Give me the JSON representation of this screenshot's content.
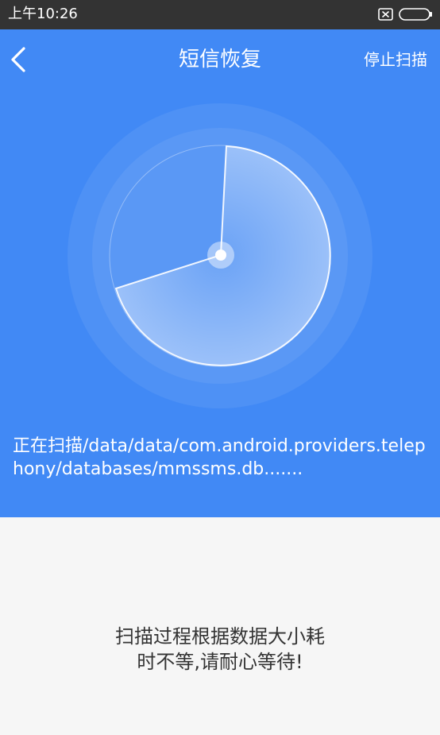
{
  "status_bar": {
    "time": "上午10:26"
  },
  "header": {
    "title": "短信恢复",
    "stop_label": "停止扫描"
  },
  "scan": {
    "path_text": "正在扫描/data/data/com.android.providers.telephony/databases/mmssms.db......."
  },
  "hint": {
    "line1": "扫描过程根据数据大小耗",
    "line2": "时不等,请耐心等待!"
  },
  "colors": {
    "header_bg": "#4189f5",
    "status_bar_bg": "#333333",
    "page_bg": "#f6f6f6",
    "hint_text": "#333333"
  },
  "icons": {
    "back": "chevron-left-icon",
    "notification": "close-box-icon",
    "battery": "battery-icon"
  }
}
